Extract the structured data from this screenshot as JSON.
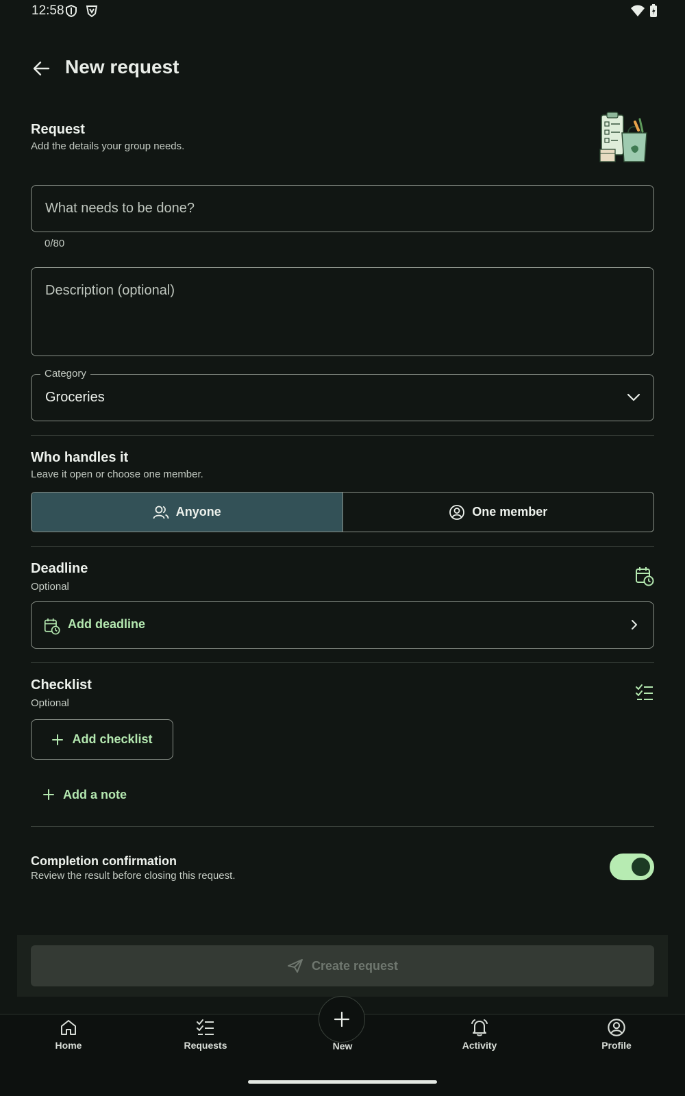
{
  "status_bar": {
    "time": "12:58"
  },
  "app_bar": {
    "title": "New request"
  },
  "request_section": {
    "title": "Request",
    "subtitle": "Add the details your group needs."
  },
  "fields": {
    "title_placeholder": "What needs to be done?",
    "title_counter": "0/80",
    "description_placeholder": "Description (optional)",
    "category_label": "Category",
    "category_value": "Groceries"
  },
  "handler_section": {
    "title": "Who handles it",
    "subtitle": "Leave it open or choose one member.",
    "options": [
      {
        "label": "Anyone",
        "selected": true
      },
      {
        "label": "One member",
        "selected": false
      }
    ]
  },
  "deadline_section": {
    "title": "Deadline",
    "subtitle": "Optional",
    "action_label": "Add deadline"
  },
  "checklist_section": {
    "title": "Checklist",
    "subtitle": "Optional",
    "add_checklist_label": "Add checklist",
    "add_note_label": "Add a note"
  },
  "confirmation_section": {
    "title": "Completion confirmation",
    "subtitle": "Review the result before closing this request.",
    "enabled": true
  },
  "submit": {
    "label": "Create request",
    "enabled": false
  },
  "bottom_nav": {
    "items": [
      {
        "label": "Home",
        "icon": "home-icon"
      },
      {
        "label": "Requests",
        "icon": "checklist-icon"
      },
      {
        "label": "New",
        "icon": "plus-icon"
      },
      {
        "label": "Activity",
        "icon": "bell-icon"
      },
      {
        "label": "Profile",
        "icon": "profile-icon"
      }
    ]
  },
  "colors": {
    "background": "#111613",
    "accent": "#b4e8b0",
    "selected_segment": "#335157",
    "toggle_track": "#b7ebb2"
  }
}
